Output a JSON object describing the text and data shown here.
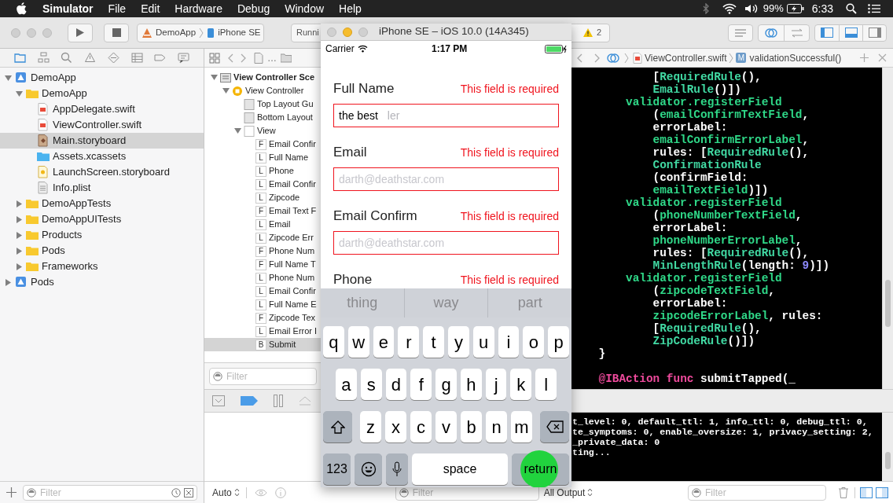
{
  "menu_bar": {
    "app": "Simulator",
    "menus": [
      "File",
      "Edit",
      "Hardware",
      "Debug",
      "Window",
      "Help"
    ],
    "battery_percent": "99%",
    "clock": "6:33"
  },
  "toolbar": {
    "scheme": "DemoApp",
    "device": "iPhone SE",
    "status": "Runni",
    "warning_count": "2",
    "editor_modes": [
      {
        "selected": false
      },
      {
        "selected": true
      },
      {
        "selected": false
      }
    ],
    "panel_toggles": [
      {
        "on": true
      },
      {
        "on": true
      },
      {
        "on": false
      }
    ]
  },
  "navigator": {
    "items": [
      {
        "label": "DemoApp",
        "kind": "project",
        "expanded": true,
        "selected": false,
        "children": [
          {
            "label": "DemoApp",
            "kind": "folder",
            "expanded": true,
            "selected": false,
            "children": [
              {
                "label": "AppDelegate.swift",
                "kind": "swift",
                "selected": false
              },
              {
                "label": "ViewController.swift",
                "kind": "swift",
                "selected": false
              },
              {
                "label": "Main.storyboard",
                "kind": "storyboard",
                "selected": true
              },
              {
                "label": "Assets.xcassets",
                "kind": "assets",
                "selected": false
              },
              {
                "label": "LaunchScreen.storyboard",
                "kind": "launchscreen",
                "selected": false
              },
              {
                "label": "Info.plist",
                "kind": "plist",
                "selected": false
              }
            ]
          },
          {
            "label": "DemoAppTests",
            "kind": "folder",
            "expanded": false,
            "selected": false
          },
          {
            "label": "DemoAppUITests",
            "kind": "folder",
            "expanded": false,
            "selected": false
          },
          {
            "label": "Products",
            "kind": "folder",
            "expanded": false,
            "selected": false
          },
          {
            "label": "Pods",
            "kind": "folder",
            "expanded": false,
            "selected": false
          },
          {
            "label": "Frameworks",
            "kind": "folder",
            "expanded": false,
            "selected": false
          }
        ]
      },
      {
        "label": "Pods",
        "kind": "project",
        "expanded": false,
        "selected": false
      }
    ],
    "filter_placeholder": "Filter"
  },
  "outline": {
    "breadcrumb_ellipsis": "…",
    "items": [
      {
        "label": "View Controller Sce",
        "kind": "scene",
        "expanded": true,
        "selected": false,
        "children": [
          {
            "label": "View Controller",
            "kind": "controller",
            "expanded": true,
            "selected": false,
            "children": [
              {
                "label": "Top Layout Gu",
                "kind": "guide",
                "selected": false
              },
              {
                "label": "Bottom Layout",
                "kind": "guide",
                "selected": false
              },
              {
                "label": "View",
                "kind": "view",
                "expanded": true,
                "selected": false,
                "children": [
                  {
                    "label": "Email Confir",
                    "badge": "F",
                    "selected": false
                  },
                  {
                    "label": "Full Name",
                    "badge": "L",
                    "selected": false
                  },
                  {
                    "label": "Phone",
                    "badge": "L",
                    "selected": false
                  },
                  {
                    "label": "Email Confir",
                    "badge": "L",
                    "selected": false
                  },
                  {
                    "label": "Zipcode",
                    "badge": "L",
                    "selected": false
                  },
                  {
                    "label": "Email Text F",
                    "badge": "F",
                    "selected": false
                  },
                  {
                    "label": "Email",
                    "badge": "L",
                    "selected": false
                  },
                  {
                    "label": "Zipcode Err",
                    "badge": "L",
                    "selected": false
                  },
                  {
                    "label": "Phone Num",
                    "badge": "F",
                    "selected": false
                  },
                  {
                    "label": "Full Name T",
                    "badge": "F",
                    "selected": false
                  },
                  {
                    "label": "Phone Num",
                    "badge": "L",
                    "selected": false
                  },
                  {
                    "label": "Email Confir",
                    "badge": "L",
                    "selected": false
                  },
                  {
                    "label": "Full Name E",
                    "badge": "L",
                    "selected": false
                  },
                  {
                    "label": "Zipcode Tex",
                    "badge": "F",
                    "selected": false
                  },
                  {
                    "label": "Email Error I",
                    "badge": "L",
                    "selected": false
                  },
                  {
                    "label": "Submit",
                    "badge": "B",
                    "selected": true
                  }
                ]
              }
            ]
          }
        ]
      }
    ],
    "filter_placeholder": "Filter"
  },
  "variables": {
    "scope": "Auto",
    "filter_placeholder": "Filter"
  },
  "editor": {
    "jump_bar": {
      "file": "ViewController.swift",
      "symbol_badge": "M",
      "symbol": "validationSuccessful()"
    },
    "code_lines": [
      {
        "kind": "argument",
        "segments": [
          {
            "kind": "plain",
            "text": "["
          },
          {
            "kind": "type",
            "text": "RequiredRule"
          },
          {
            "kind": "plain",
            "text": "(),"
          }
        ]
      },
      {
        "kind": "argument",
        "segments": [
          {
            "kind": "type",
            "text": "EmailRule"
          },
          {
            "kind": "plain",
            "text": "()])"
          }
        ]
      },
      {
        "kind": "call",
        "segments": [
          {
            "kind": "member",
            "text": "validator.registerField"
          }
        ]
      },
      {
        "kind": "argument",
        "segments": [
          {
            "kind": "plain",
            "text": "("
          },
          {
            "kind": "member",
            "text": "emailConfirmTextField"
          },
          {
            "kind": "plain",
            "text": ","
          }
        ]
      },
      {
        "kind": "argument",
        "segments": [
          {
            "kind": "plain",
            "text": "errorLabel:"
          }
        ]
      },
      {
        "kind": "argument",
        "segments": [
          {
            "kind": "member",
            "text": "emailConfirmErrorLabel"
          },
          {
            "kind": "plain",
            "text": ","
          }
        ]
      },
      {
        "kind": "argument",
        "segments": [
          {
            "kind": "plain",
            "text": "rules: ["
          },
          {
            "kind": "type",
            "text": "RequiredRule"
          },
          {
            "kind": "plain",
            "text": "(),"
          }
        ]
      },
      {
        "kind": "argument",
        "segments": [
          {
            "kind": "type",
            "text": "ConfirmationRule"
          }
        ]
      },
      {
        "kind": "argument",
        "segments": [
          {
            "kind": "plain",
            "text": "(confirmField:"
          }
        ]
      },
      {
        "kind": "argument",
        "segments": [
          {
            "kind": "member",
            "text": "emailTextField"
          },
          {
            "kind": "plain",
            "text": ")])"
          }
        ]
      },
      {
        "kind": "call",
        "segments": [
          {
            "kind": "member",
            "text": "validator.registerField"
          }
        ]
      },
      {
        "kind": "argument",
        "segments": [
          {
            "kind": "plain",
            "text": "("
          },
          {
            "kind": "member",
            "text": "phoneNumberTextField"
          },
          {
            "kind": "plain",
            "text": ","
          }
        ]
      },
      {
        "kind": "argument",
        "segments": [
          {
            "kind": "plain",
            "text": "errorLabel:"
          }
        ]
      },
      {
        "kind": "argument",
        "segments": [
          {
            "kind": "member",
            "text": "phoneNumberErrorLabel"
          },
          {
            "kind": "plain",
            "text": ","
          }
        ]
      },
      {
        "kind": "argument",
        "segments": [
          {
            "kind": "plain",
            "text": "rules: ["
          },
          {
            "kind": "type",
            "text": "RequiredRule"
          },
          {
            "kind": "plain",
            "text": "(),"
          }
        ]
      },
      {
        "kind": "argument",
        "segments": [
          {
            "kind": "type",
            "text": "MinLengthRule"
          },
          {
            "kind": "plain",
            "text": "(length: "
          },
          {
            "kind": "number",
            "text": "9"
          },
          {
            "kind": "plain",
            "text": ")])"
          }
        ]
      },
      {
        "kind": "call",
        "segments": [
          {
            "kind": "member",
            "text": "validator.registerField"
          }
        ]
      },
      {
        "kind": "argument",
        "segments": [
          {
            "kind": "plain",
            "text": "("
          },
          {
            "kind": "member",
            "text": "zipcodeTextField"
          },
          {
            "kind": "plain",
            "text": ","
          }
        ]
      },
      {
        "kind": "argument",
        "segments": [
          {
            "kind": "plain",
            "text": "errorLabel:"
          }
        ]
      },
      {
        "kind": "argument",
        "segments": [
          {
            "kind": "member",
            "text": "zipcodeErrorLabel"
          },
          {
            "kind": "plain",
            "text": ", rules:"
          }
        ]
      },
      {
        "kind": "argument",
        "segments": [
          {
            "kind": "plain",
            "text": "["
          },
          {
            "kind": "type",
            "text": "RequiredRule"
          },
          {
            "kind": "plain",
            "text": "(),"
          }
        ]
      },
      {
        "kind": "argument",
        "segments": [
          {
            "kind": "type",
            "text": "ZipCodeRule"
          },
          {
            "kind": "plain",
            "text": "()])"
          }
        ]
      },
      {
        "kind": "closing",
        "segments": [
          {
            "kind": "plain",
            "text": "}"
          }
        ]
      },
      {
        "kind": "blank"
      },
      {
        "kind": "declaration",
        "segments": [
          {
            "kind": "keyword",
            "text": "@IBAction func"
          },
          {
            "kind": "plain",
            "text": " submitTapped(_"
          }
        ]
      }
    ]
  },
  "console": {
    "lines": [
      "t_level: 0, default_ttl: 1, info_ttl: 0, debug_ttl: 0,",
      "te_symptoms: 0, enable_oversize: 1, privacy_setting: 2,",
      "_private_data: 0",
      "ting..."
    ],
    "scope": "All Output",
    "filter_placeholder": "Filter"
  },
  "simulator": {
    "title": "iPhone SE – iOS 10.0 (14A345)",
    "carrier": "Carrier",
    "time": "1:17 PM",
    "fields": [
      {
        "label": "Full Name",
        "error": "This field is required",
        "value": "the best",
        "placeholder": "ler"
      },
      {
        "label": "Email",
        "error": "This field is required",
        "placeholder": "darth@deathstar.com"
      },
      {
        "label": "Email Confirm",
        "error": "This field is required",
        "placeholder": "darth@deathstar.com"
      },
      {
        "label": "Phone",
        "error": "This field is required"
      }
    ],
    "suggestions": [
      "thing",
      "way",
      "part"
    ],
    "keyboard": {
      "rows": [
        [
          "q",
          "w",
          "e",
          "r",
          "t",
          "y",
          "u",
          "i",
          "o",
          "p"
        ],
        [
          "a",
          "s",
          "d",
          "f",
          "g",
          "h",
          "j",
          "k",
          "l"
        ],
        [
          "z",
          "x",
          "c",
          "v",
          "b",
          "n",
          "m"
        ]
      ],
      "numbers_key": "123",
      "space_key": "space",
      "return_key": "return"
    }
  }
}
